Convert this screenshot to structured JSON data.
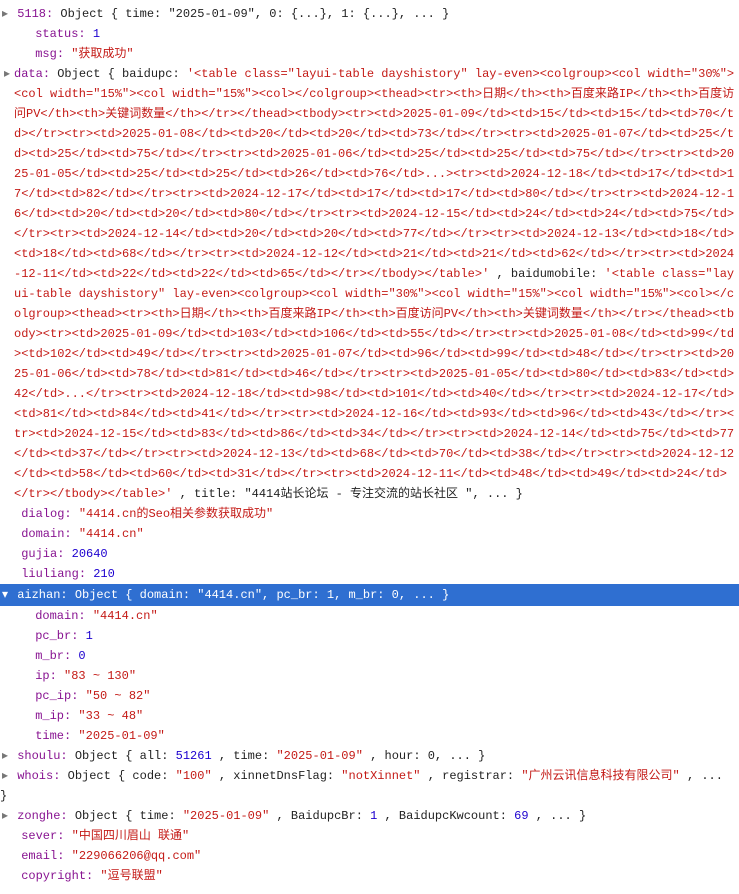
{
  "row_5118": {
    "key": "5118",
    "preview": "Object { time: \"2025-01-09\", 0: {...}, 1: {...}, ... }"
  },
  "status": {
    "key": "status",
    "value": 1
  },
  "msg": {
    "key": "msg",
    "value": "\"获取成功\""
  },
  "data": {
    "key": "data",
    "prefix": "Object { baidupc: ",
    "baidupc_html": "'<table class=\"layui-table dayshistory\" lay-even><colgroup><col width=\"30%\"><col width=\"15%\"><col width=\"15%\"><col></colgroup><thead><tr><th>日期</th><th>百度来路IP</th><th>百度访问PV</th><th>关键词数量</th></tr></thead><tbody><tr><td>2025-01-09</td><td>15</td><td>15</td><td>70</td></tr><tr><td>2025-01-08</td><td>20</td><td>20</td><td>73</td></tr><tr><td>2025-01-07</td><td>25</td><td>25</td><td>75</td></tr><tr><td>2025-01-06</td><td>25</td><td>25</td><td>75</td></tr><tr><td>2025-01-05</td><td>25</td><td>25</td><td>26</td><td>76</td>...><tr><td>2024-12-18</td><td>17</td><td>17</td><td>82</td></tr><tr><td>2024-12-17</td><td>17</td><td>17</td><td>80</td></tr><tr><td>2024-12-16</td><td>20</td><td>20</td><td>80</td></tr><tr><td>2024-12-15</td><td>24</td><td>24</td><td>75</td></tr><tr><td>2024-12-14</td><td>20</td><td>20</td><td>77</td></tr><tr><td>2024-12-13</td><td>18</td><td>18</td><td>68</td></tr><tr><td>2024-12-12</td><td>21</td><td>21</td><td>62</td></tr><tr><td>2024-12-11</td><td>22</td><td>22</td><td>65</td></tr></tbody></table>'",
    "mid": ", baidumobile: ",
    "baidumobile_html": "'<table class=\"layui-table dayshistory\" lay-even><colgroup><col width=\"30%\"><col width=\"15%\"><col width=\"15%\"><col></colgroup><thead><tr><th>日期</th><th>百度来路IP</th><th>百度访问PV</th><th>关键词数量</th></tr></thead><tbody><tr><td>2025-01-09</td><td>103</td><td>106</td><td>55</td></tr><tr><td>2025-01-08</td><td>99</td><td>102</td><td>49</td></tr><tr><td>2025-01-07</td><td>96</td><td>99</td><td>48</td></tr><tr><td>2025-01-06</td><td>78</td><td>81</td><td>46</td></tr><tr><td>2025-01-05</td><td>80</td><td>83</td><td>42</td>...</tr><tr><td>2024-12-18</td><td>98</td><td>101</td><td>40</td></tr><tr><td>2024-12-17</td><td>81</td><td>84</td><td>41</td></tr><tr><td>2024-12-16</td><td>93</td><td>96</td><td>43</td></tr><tr><td>2024-12-15</td><td>83</td><td>86</td><td>34</td></tr><tr><td>2024-12-14</td><td>75</td><td>77</td><td>37</td></tr><tr><td>2024-12-13</td><td>68</td><td>70</td><td>38</td></tr><tr><td>2024-12-12</td><td>58</td><td>60</td><td>31</td></tr><tr><td>2024-12-11</td><td>48</td><td>49</td><td>24</td></tr></tbody></table>'",
    "tail": ", title: \"4414站长论坛 - 专注交流的站长社区 \", ... }"
  },
  "dialog": {
    "key": "dialog",
    "value": "\"4414.cn的Seo相关参数获取成功\""
  },
  "domain": {
    "key": "domain",
    "value": "\"4414.cn\""
  },
  "gujia": {
    "key": "gujia",
    "value": 20640
  },
  "liuliang": {
    "key": "liuliang",
    "value": 210
  },
  "aizhan": {
    "key": "aizhan",
    "preview": "Object { domain: \"4414.cn\", pc_br: 1, m_br: 0, ... }",
    "domain": {
      "key": "domain",
      "value": "\"4414.cn\""
    },
    "pc_br": {
      "key": "pc_br",
      "value": 1
    },
    "m_br": {
      "key": "m_br",
      "value": 0
    },
    "ip": {
      "key": "ip",
      "value": "\"83 ~ 130\""
    },
    "pc_ip": {
      "key": "pc_ip",
      "value": "\"50 ~ 82\""
    },
    "m_ip": {
      "key": "m_ip",
      "value": "\"33 ~ 48\""
    },
    "time": {
      "key": "time",
      "value": "\"2025-01-09\""
    }
  },
  "shoulu": {
    "key": "shoulu",
    "pre": "Object { all: ",
    "all": 51261,
    "mid": ", time: ",
    "time": "\"2025-01-09\"",
    "tail": ", hour: 0, ... }"
  },
  "whois": {
    "key": "whois",
    "pre": "Object { code: ",
    "code": "\"100\"",
    "mid1": ", xinnetDnsFlag: ",
    "flag": "\"notXinnet\"",
    "mid2": ", registrar: ",
    "reg": "\"广州云讯信息科技有限公司\"",
    "tail": ", ... }"
  },
  "zonghe": {
    "key": "zonghe",
    "pre": "Object { time: ",
    "time": "\"2025-01-09\"",
    "mid1": ", BaidupcBr: ",
    "b1": 1,
    "mid2": ", BaidupcKwcount: ",
    "b2": 69,
    "tail": ", ... }"
  },
  "sever": {
    "key": "sever",
    "value": "\"中国四川眉山 联通\""
  },
  "email": {
    "key": "email",
    "value": "\"229066206@qq.com\""
  },
  "copyright": {
    "key": "copyright",
    "value": "\"逗号联盟\""
  },
  "glyph": {
    "right": "▸",
    "down": "▾"
  }
}
